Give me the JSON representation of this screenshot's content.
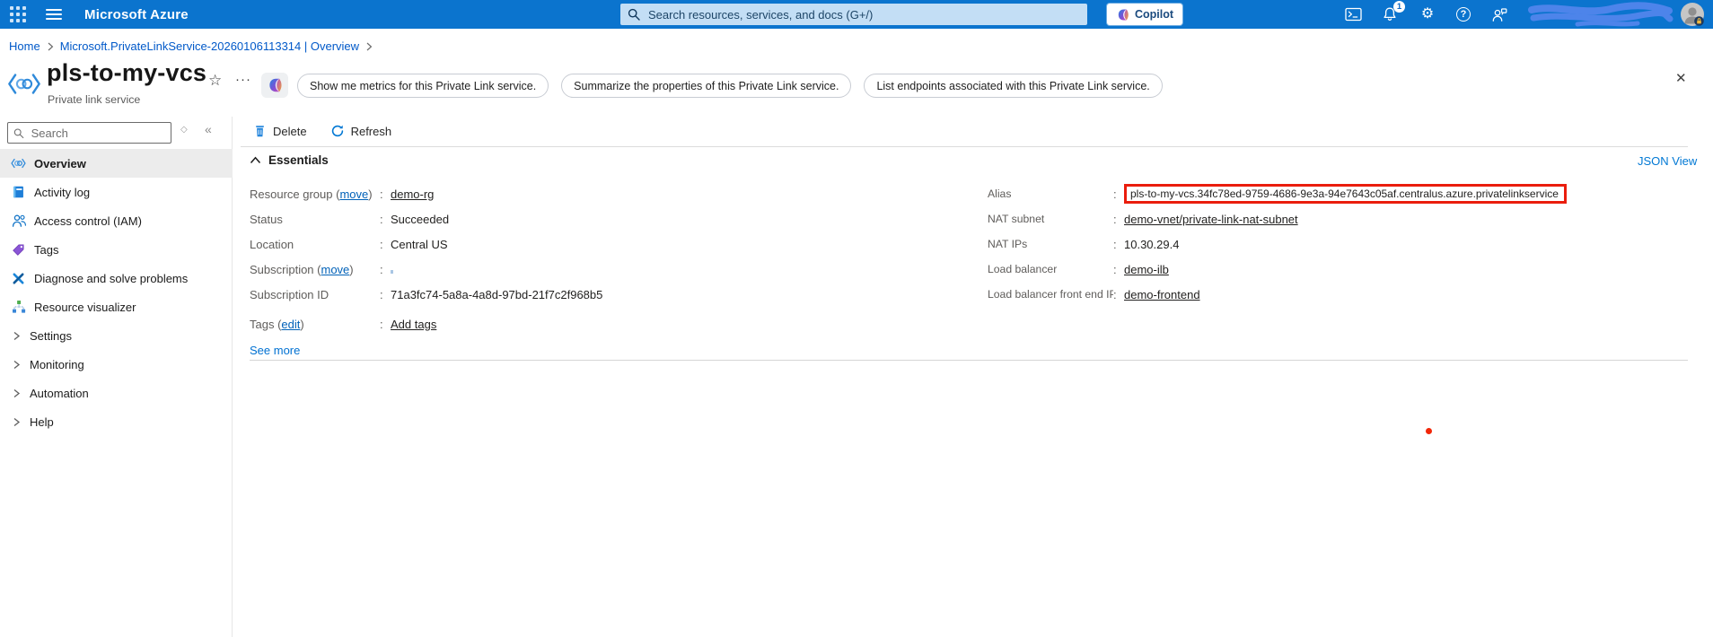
{
  "topbar": {
    "title": "Microsoft Azure",
    "search_placeholder": "Search resources, services, and docs (G+/)",
    "copilot_label": "Copilot",
    "notification_count": "1"
  },
  "breadcrumb": {
    "home": "Home",
    "resource": "Microsoft.PrivateLinkService-20260106113314 | Overview"
  },
  "page": {
    "title": "pls-to-my-vcs",
    "subtitle": "Private link service",
    "star_icon": "☆",
    "more_icon": "···",
    "close_icon": "✕",
    "copilot_suggestions": [
      "Show me metrics for this Private Link service.",
      "Summarize the properties of this Private Link service.",
      "List endpoints associated with this Private Link service."
    ]
  },
  "sidebar": {
    "search_placeholder": "Search",
    "diamond_icon": "◇",
    "collapse_icon": "«",
    "items": [
      {
        "label": "Overview"
      },
      {
        "label": "Activity log"
      },
      {
        "label": "Access control (IAM)"
      },
      {
        "label": "Tags"
      },
      {
        "label": "Diagnose and solve problems"
      },
      {
        "label": "Resource visualizer"
      },
      {
        "label": "Settings"
      },
      {
        "label": "Monitoring"
      },
      {
        "label": "Automation"
      },
      {
        "label": "Help"
      }
    ]
  },
  "toolbar": {
    "delete_label": "Delete",
    "refresh_label": "Refresh"
  },
  "essentials": {
    "header": "Essentials",
    "json_view": "JSON View",
    "see_more": "See more",
    "left": {
      "resource_group": {
        "label_prefix": "Resource group (",
        "link": "move",
        "label_suffix": ")",
        "value": "demo-rg"
      },
      "status": {
        "label": "Status",
        "value": "Succeeded"
      },
      "location": {
        "label": "Location",
        "value": "Central US"
      },
      "subscription": {
        "label_prefix": "Subscription (",
        "link": "move",
        "label_suffix": ")",
        "value": ""
      },
      "subscription_id": {
        "label": "Subscription ID",
        "value": "71a3fc74-5a8a-4a8d-97bd-21f7c2f968b5"
      },
      "tags": {
        "label_prefix": "Tags (",
        "link": "edit",
        "label_suffix": ")",
        "value": "Add tags"
      }
    },
    "right": {
      "alias": {
        "label": "Alias",
        "value": "pls-to-my-vcs.34fc78ed-9759-4686-9e3a-94e7643c05af.centralus.azure.privatelinkservice"
      },
      "nat_subnet": {
        "label": "NAT subnet",
        "value": "demo-vnet/private-link-nat-subnet"
      },
      "nat_ips": {
        "label": "NAT IPs",
        "value": "10.30.29.4"
      },
      "load_balancer": {
        "label": "Load balancer",
        "value": "demo-ilb"
      },
      "lb_frontend_ip": {
        "label": "Load balancer front end IP",
        "value": "demo-frontend"
      }
    }
  },
  "punct": {
    "colon": ":"
  },
  "colors": {
    "header_blue": "#0b74ce",
    "accent": "#0078d4",
    "link": "#0061b8",
    "highlight_red": "#ea1d0d"
  }
}
